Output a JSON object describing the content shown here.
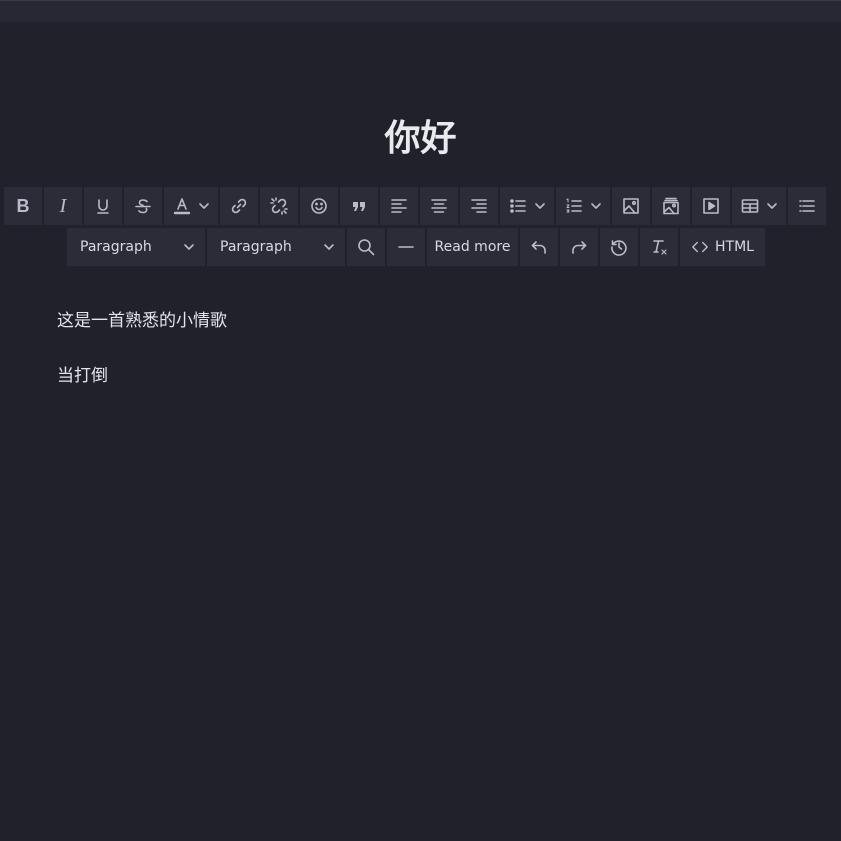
{
  "document": {
    "title": "你好",
    "paragraphs": [
      "这是一首熟悉的小情歌",
      "当打倒"
    ]
  },
  "toolbar": {
    "row1": [
      {
        "name": "bold-button",
        "icon": "bold-icon"
      },
      {
        "name": "italic-button",
        "icon": "italic-icon"
      },
      {
        "name": "underline-button",
        "icon": "underline-icon"
      },
      {
        "name": "strikethrough-button",
        "icon": "strikethrough-icon"
      },
      {
        "name": "text-color-button",
        "icon": "text-color-icon",
        "dropdown": true
      },
      {
        "name": "link-button",
        "icon": "link-icon"
      },
      {
        "name": "unlink-button",
        "icon": "unlink-icon"
      },
      {
        "name": "emoji-button",
        "icon": "emoji-icon"
      },
      {
        "name": "blockquote-button",
        "icon": "quote-icon"
      },
      {
        "name": "align-left-button",
        "icon": "align-left-icon"
      },
      {
        "name": "align-center-button",
        "icon": "align-center-icon"
      },
      {
        "name": "align-right-button",
        "icon": "align-right-icon"
      },
      {
        "name": "bullet-list-button",
        "icon": "bullet-list-icon",
        "dropdown": true
      },
      {
        "name": "numbered-list-button",
        "icon": "numbered-list-icon",
        "dropdown": true
      },
      {
        "name": "image-button",
        "icon": "image-icon"
      },
      {
        "name": "gallery-button",
        "icon": "gallery-icon"
      },
      {
        "name": "media-button",
        "icon": "media-play-icon"
      },
      {
        "name": "table-button",
        "icon": "table-icon",
        "dropdown": true
      },
      {
        "name": "more-button",
        "icon": "more-list-icon"
      }
    ],
    "block_format_label": "Paragraph",
    "font_format_label": "Paragraph",
    "read_more_label": "Read more",
    "html_label": "HTML"
  }
}
